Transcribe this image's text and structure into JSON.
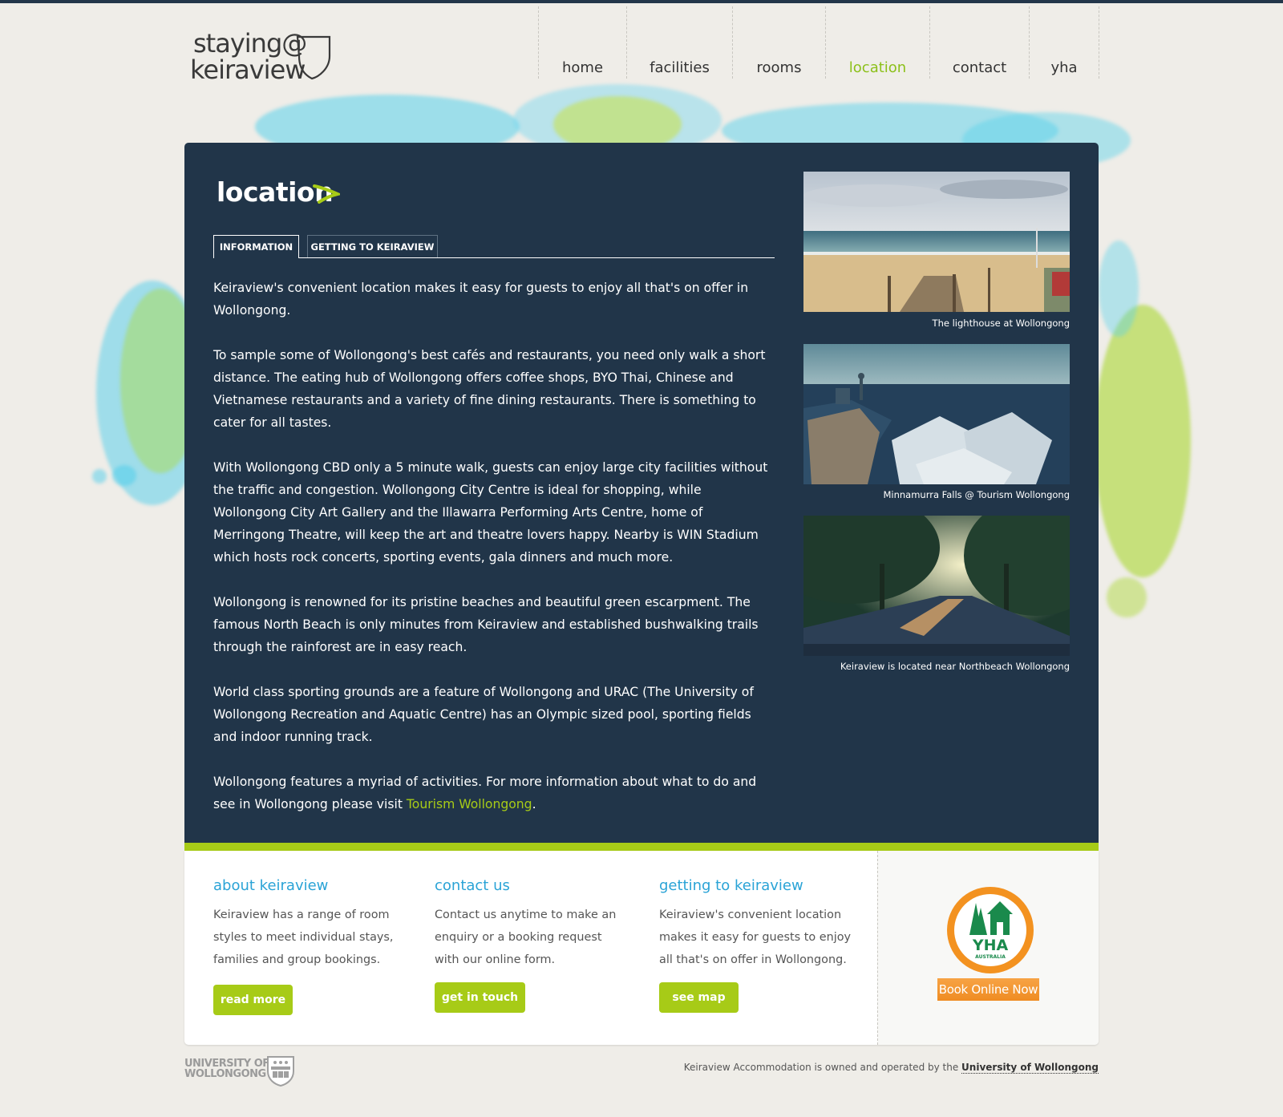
{
  "brand": {
    "line1": "staying@",
    "line2": "keiraview"
  },
  "nav": [
    {
      "label": "home"
    },
    {
      "label": "facilities"
    },
    {
      "label": "rooms"
    },
    {
      "label": "location",
      "active": true
    },
    {
      "label": "contact"
    },
    {
      "label": "yha"
    }
  ],
  "page": {
    "title": "location",
    "tabs": [
      {
        "label": "INFORMATION",
        "active": true
      },
      {
        "label": "GETTING TO KEIRAVIEW"
      }
    ],
    "paragraphs": [
      "Keiraview's convenient location makes it easy for guests to enjoy all that's on offer in Wollongong.",
      "To sample some of Wollongong's best cafés and restaurants, you need only walk a short distance. The eating hub of Wollongong offers coffee shops, BYO Thai, Chinese and Vietnamese restaurants and a variety of fine dining restaurants. There is something to cater for all tastes.",
      "With Wollongong CBD only a 5 minute walk, guests can enjoy large city facilities without the traffic and congestion. Wollongong City Centre is ideal for shopping, while Wollongong City Art Gallery and the Illawarra Performing Arts Centre, home of Merringong Theatre, will keep the art and theatre lovers happy. Nearby is WIN Stadium which hosts rock concerts, sporting events, gala dinners and much more.",
      "Wollongong is renowned for its pristine beaches and beautiful green escarpment. The famous North Beach is only minutes from Keiraview and established bushwalking trails through the rainforest are in easy reach.",
      "World class sporting grounds are a feature of Wollongong and URAC (The University of Wollongong Recreation and Aquatic Centre) has an Olympic sized pool, sporting fields and indoor running track."
    ],
    "last_paragraph": {
      "before": "Wollongong features a myriad of activities. For more information about what to do and see in Wollongong please visit ",
      "link": "Tourism Wollongong",
      "after": "."
    }
  },
  "photos": [
    {
      "caption": "The lighthouse at Wollongong"
    },
    {
      "caption": "Minnamurra Falls @ Tourism Wollongong"
    },
    {
      "caption": "Keiraview is located near Northbeach Wollongong"
    }
  ],
  "footer": {
    "about": {
      "heading": "about keiraview",
      "text": "Keiraview has a range of room styles to meet individual stays, families and group bookings.",
      "button": "read more"
    },
    "contact": {
      "heading": "contact us",
      "text": "Contact us anytime to make an enquiry or a booking request with our online form.",
      "button": "get in touch"
    },
    "getting": {
      "heading": "getting to keiraview",
      "text": "Keiraview's convenient location makes it easy for guests to enjoy all that's on offer in Wollongong.",
      "button": "see map"
    },
    "yha": {
      "logo_text": "YHA",
      "logo_sub": "AUSTRALIA",
      "book_label": "Book Online Now"
    }
  },
  "bottom": {
    "uow_line1": "UNIVERSITY OF",
    "uow_line2": "WOLLONGONG",
    "note_text": "Keiraview Accommodation is owned and operated by the ",
    "note_link": "University of Wollongong"
  },
  "colors": {
    "accent_green": "#a7cb17",
    "panel_navy": "#213549",
    "heading_blue": "#2aa3d6",
    "yha_orange": "#f39220",
    "yha_green": "#1a8a4c"
  }
}
